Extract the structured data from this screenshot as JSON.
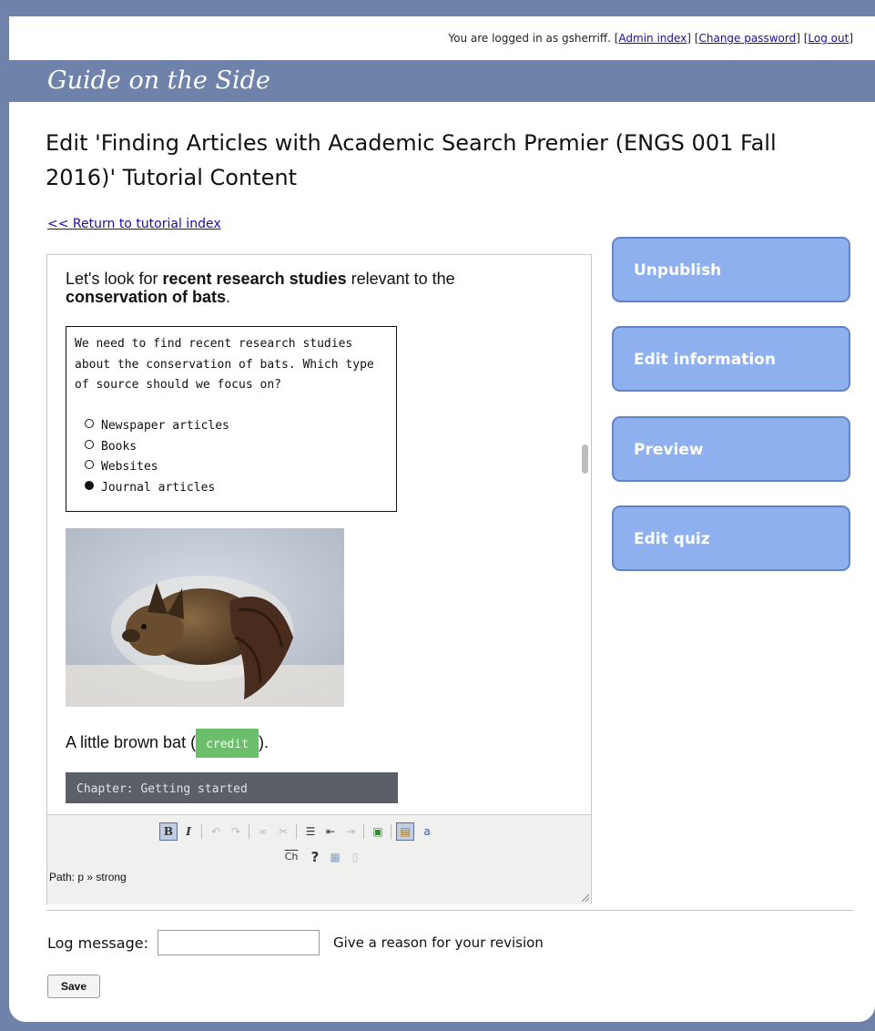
{
  "header": {
    "logged_in_text": "You are logged in as gsherriff.",
    "links": [
      "Admin index",
      "Change password",
      "Log out"
    ],
    "site_title": "Guide on the Side"
  },
  "page_title": "Edit 'Finding Articles with Academic Search Premier (ENGS 001 Fall 2016)' Tutorial Content",
  "return_link": "<< Return to tutorial index",
  "editor": {
    "intro": {
      "part1": "Let's look for ",
      "bold1": "recent research studies",
      "part2": " relevant to the ",
      "bold2": "conservation of bats",
      "part3": "."
    },
    "quiz": {
      "question": "We need to find recent research studies about the conservation of bats. Which type of source should we focus on?",
      "options": [
        {
          "label": "Newspaper articles",
          "selected": false
        },
        {
          "label": "Books",
          "selected": false
        },
        {
          "label": "Websites",
          "selected": false
        },
        {
          "label": "Journal articles",
          "selected": true
        }
      ]
    },
    "caption_before": "A little brown bat (",
    "credit_label": "credit",
    "caption_after": ").",
    "chapter_label": "Chapter: Getting started",
    "path_text": "Path: p » strong"
  },
  "toolbar": {
    "bold": "B",
    "italic": "I",
    "chapter_icon": "Ch",
    "question_icon": "?"
  },
  "side_buttons": [
    "Unpublish",
    "Edit information",
    "Preview",
    "Edit quiz"
  ],
  "form": {
    "log_label": "Log message:",
    "log_value": "",
    "log_hint": "Give a reason for your revision",
    "save_label": "Save"
  },
  "colors": {
    "banner": "#6e82aa",
    "side_button": "#8fb0ee",
    "credit_chip": "#6bbf6b",
    "chapter_bar": "#5a5f68"
  }
}
